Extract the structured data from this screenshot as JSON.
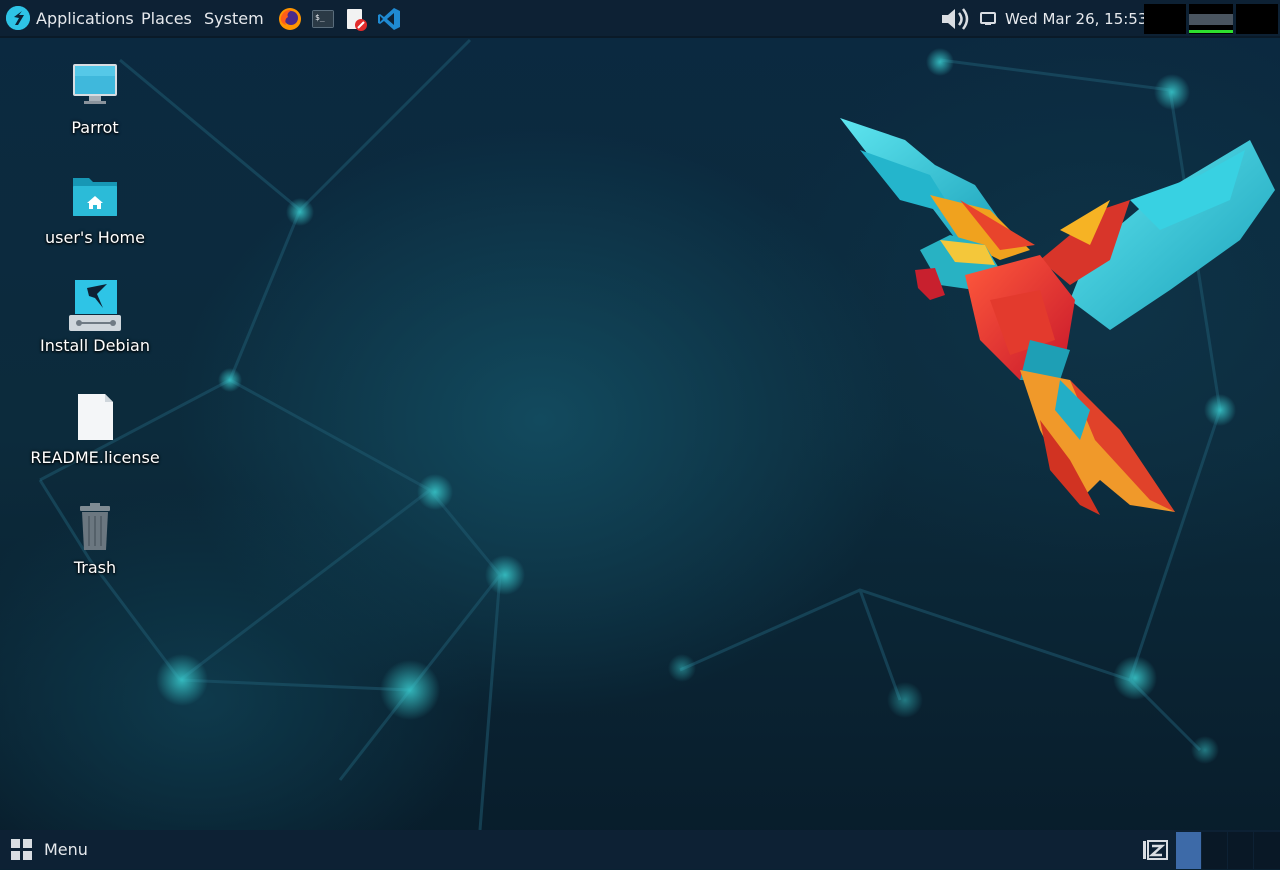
{
  "top_panel": {
    "menus": [
      "Applications",
      "Places",
      "System"
    ],
    "clock": "Wed Mar 26, 15:53"
  },
  "launchers": [
    "firefox-icon",
    "terminal-icon",
    "text-editor-icon",
    "vscode-icon"
  ],
  "desktop_icons": [
    {
      "label": "Parrot",
      "icon": "computer-icon"
    },
    {
      "label": "user's Home",
      "icon": "home-folder-icon"
    },
    {
      "label": "Install Debian",
      "icon": "installer-icon"
    },
    {
      "label": "README.license",
      "icon": "file-icon"
    },
    {
      "label": "Trash",
      "icon": "trash-icon"
    }
  ],
  "bottom_panel": {
    "menu_label": "Menu"
  },
  "colors": {
    "panel_bg": "#0d2134",
    "accent_cyan": "#2ec4e6",
    "workspace_active": "#3d6aa8"
  }
}
